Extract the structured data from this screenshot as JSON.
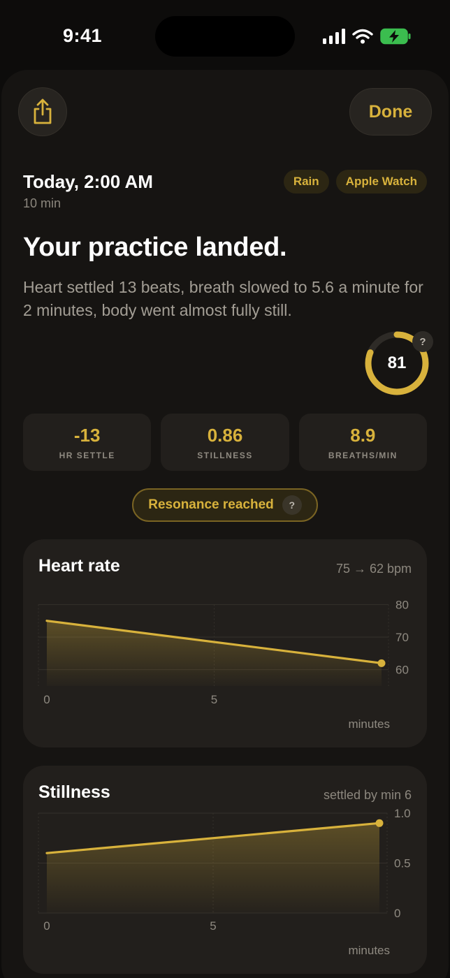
{
  "status_bar": {
    "time": "9:41"
  },
  "toolbar": {
    "done_label": "Done"
  },
  "session": {
    "date": "Today, 2:00 AM",
    "duration": "10 min",
    "tags": [
      "Rain",
      "Apple Watch"
    ]
  },
  "headline": "Your practice landed.",
  "summary": "Heart settled 13 beats, breath slowed to 5.6 a minute for 2 minutes, body went almost fully still.",
  "score": {
    "value": "81",
    "fraction": 0.81,
    "help": "?"
  },
  "stats": [
    {
      "value": "-13",
      "label": "HR SETTLE"
    },
    {
      "value": "0.86",
      "label": "STILLNESS"
    },
    {
      "value": "8.9",
      "label": "BREATHS/MIN"
    }
  ],
  "resonance": {
    "label": "Resonance reached",
    "help": "?"
  },
  "colors": {
    "accent": "#d8b23c",
    "background": "#0d0c0b",
    "card": "#221f1c"
  },
  "chart_data": [
    {
      "type": "area",
      "title": "Heart rate",
      "subtitle": "75 → 62 bpm",
      "xlabel": "minutes",
      "x": [
        0,
        10
      ],
      "y": [
        75,
        62
      ],
      "xticks": [
        "0",
        "5"
      ],
      "xtick_values": [
        0,
        5
      ],
      "yticks": [
        "80",
        "70",
        "60"
      ],
      "ytick_values": [
        80,
        70,
        60
      ],
      "xlim": [
        0,
        10
      ],
      "ylim": [
        55,
        82
      ],
      "grid": true,
      "end_marker": true
    },
    {
      "type": "area",
      "title": "Stillness",
      "subtitle": "settled by min 6",
      "xlabel": "minutes",
      "x": [
        0,
        10
      ],
      "y": [
        0.6,
        0.9
      ],
      "xticks": [
        "0",
        "5"
      ],
      "xtick_values": [
        0,
        5
      ],
      "yticks": [
        "1.0",
        "0.5",
        "0"
      ],
      "ytick_values": [
        1.0,
        0.5,
        0
      ],
      "xlim": [
        0,
        10
      ],
      "ylim": [
        0,
        1.0
      ],
      "grid": true,
      "end_marker": true
    }
  ]
}
